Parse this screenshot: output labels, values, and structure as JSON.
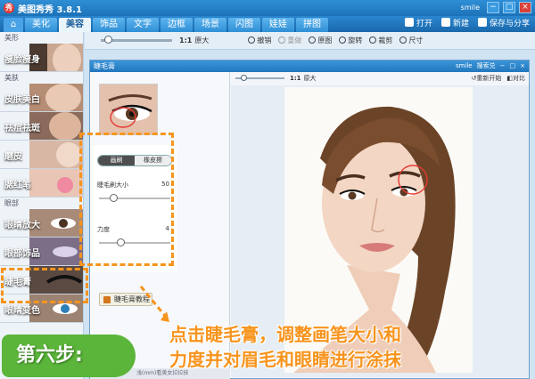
{
  "app": {
    "title": "美图秀秀 3.8.1",
    "logo_glyph": "秀",
    "user": "smile"
  },
  "tabs": [
    "美化",
    "美容",
    "饰品",
    "文字",
    "边框",
    "场景",
    "闪图",
    "娃娃",
    "拼图"
  ],
  "active_tab": "美容",
  "tab_actions": {
    "open": "打开",
    "new": "新建",
    "save": "保存与分享"
  },
  "sidebar": {
    "sections": [
      {
        "label": "美形",
        "items": [
          "瘦脸瘦身"
        ]
      },
      {
        "label": "美肤",
        "items": [
          "皮肤美白",
          "祛痘祛斑",
          "磨皮",
          "腮红笔"
        ]
      },
      {
        "label": "眼部",
        "items": [
          "眼睛放大",
          "眼部饰品",
          "睫毛膏",
          "眼睛变色"
        ]
      }
    ]
  },
  "toolbar": {
    "ratio": "1:1",
    "original_size": "原大",
    "undo": "撤销",
    "redo": "重做",
    "original": "原图",
    "rotate": "旋转",
    "crop": "裁剪",
    "resize": "尺寸"
  },
  "dialog": {
    "title": "睫毛膏",
    "user": "smile",
    "search": "搜索兑",
    "ratio": "1:1",
    "original_size": "原大",
    "restart": "重新开始",
    "compare": "对比",
    "mode_active": "画刷",
    "mode_inactive": "橡皮擦",
    "brush_size_label": "睫毛刷大小",
    "brush_size_value": "50",
    "brush_size_fraction": 0.2,
    "strength_label": "力度",
    "strength_value": "4",
    "strength_fraction": 0.3,
    "tutorial": "睫毛膏教程",
    "status": "浅(mm)看美女拉拉技"
  },
  "annotation": {
    "instruction_line1": "点击睫毛膏，调整画笔大小和",
    "instruction_line2": "力度并对眉毛和眼睛进行涂抹",
    "step": "第六步:"
  },
  "colors": {
    "accent": "#f7941d",
    "badge": "#5bb53b",
    "titlebar": "#1c72b8"
  }
}
